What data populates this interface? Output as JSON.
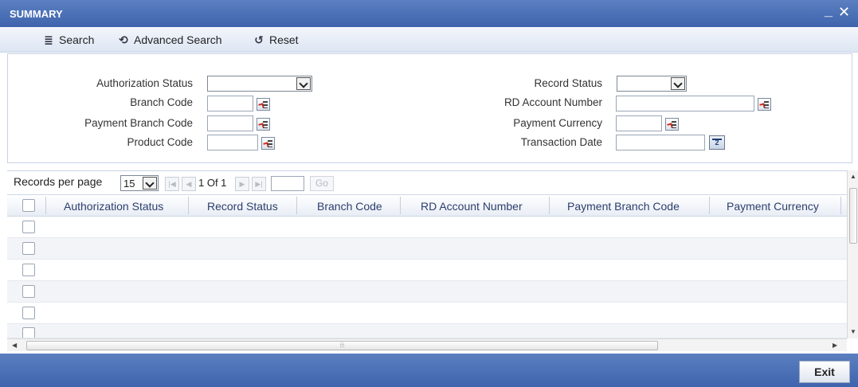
{
  "window": {
    "title": "SUMMARY",
    "minimize_label": "_",
    "close_label": "✕"
  },
  "toolbar": {
    "search_label": "Search",
    "advanced_search_label": "Advanced Search",
    "reset_label": "Reset"
  },
  "criteria": {
    "authorization_status_label": "Authorization Status",
    "branch_code_label": "Branch Code",
    "payment_branch_code_label": "Payment Branch Code",
    "product_code_label": "Product Code",
    "record_status_label": "Record Status",
    "rd_account_number_label": "RD Account Number",
    "payment_currency_label": "Payment Currency",
    "transaction_date_label": "Transaction Date",
    "values": {
      "authorization_status": "",
      "branch_code": "",
      "payment_branch_code": "",
      "product_code": "",
      "record_status": "",
      "rd_account_number": "",
      "payment_currency": "",
      "transaction_date": ""
    }
  },
  "pager": {
    "records_per_page_label": "Records per page",
    "records_per_page": "15",
    "page_info": "1 Of 1",
    "page_input": "",
    "go_label": "Go"
  },
  "grid": {
    "columns": [
      "Authorization Status",
      "Record Status",
      "Branch Code",
      "RD Account Number",
      "Payment Branch Code",
      "Payment Currency"
    ],
    "row_count": 6
  },
  "footer": {
    "exit_label": "Exit"
  },
  "colors": {
    "header_blue": "#4a6fb5",
    "link_blue": "#2c3e6d"
  }
}
